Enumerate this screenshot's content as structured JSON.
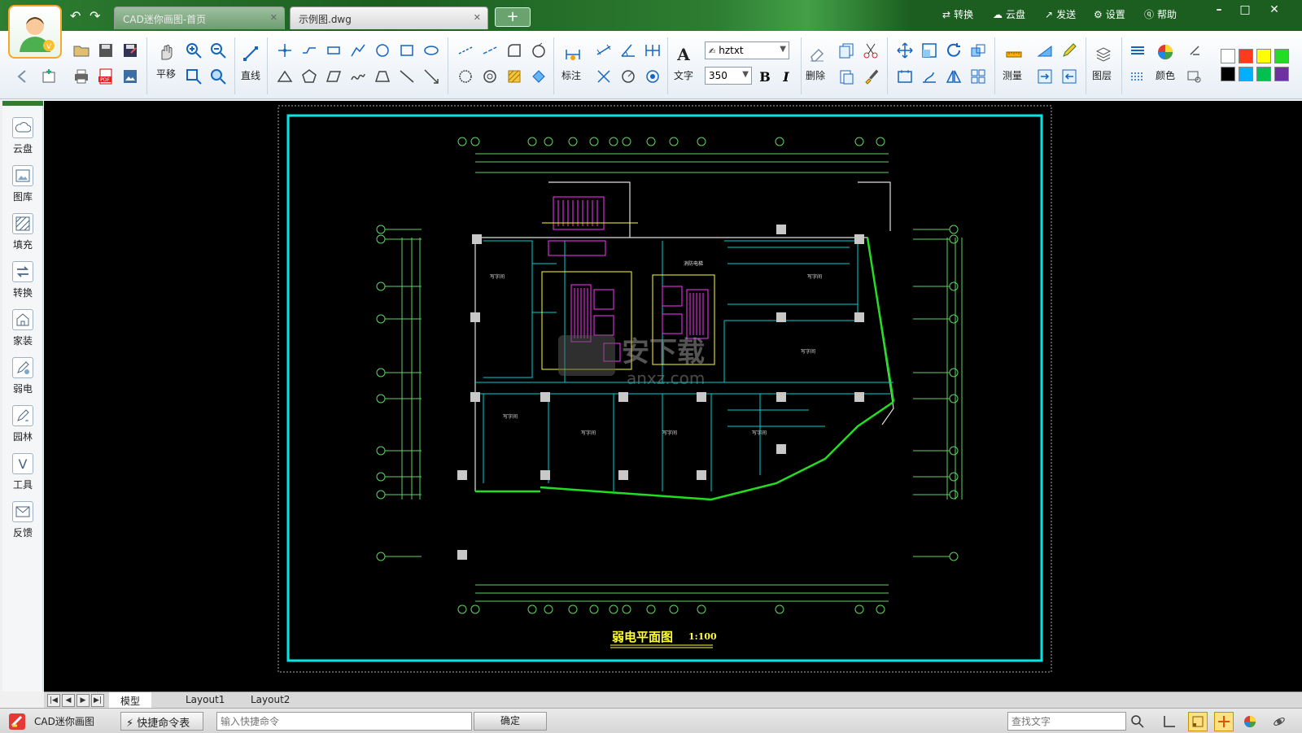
{
  "titlebar": {
    "tabs": [
      {
        "label": "CAD迷你画图-首页"
      },
      {
        "label": "示例图.dwg"
      }
    ],
    "add_tab": "+",
    "menu": {
      "convert": "转换",
      "cloud": "云盘",
      "send": "发送",
      "settings": "设置",
      "help": "帮助"
    }
  },
  "toolbar": {
    "pan": "平移",
    "line": "直线",
    "dimension": "标注",
    "text": "文字",
    "font": "hztxt",
    "font_size": "350",
    "bold": "B",
    "italic": "I",
    "delete": "删除",
    "measure": "测量",
    "layer": "图层",
    "color": "颜色",
    "colors": [
      "#ffffff",
      "#ff3b1f",
      "#ffff00",
      "#22dd22",
      "#000000",
      "#00b0ff",
      "#00c050",
      "#7030a0"
    ]
  },
  "sidebar": {
    "items": [
      {
        "label": "云盘",
        "icon": "cloud-icon"
      },
      {
        "label": "图库",
        "icon": "gallery-icon"
      },
      {
        "label": "填充",
        "icon": "hatch-icon"
      },
      {
        "label": "转换",
        "icon": "convert-icon"
      },
      {
        "label": "家装",
        "icon": "home-decor-icon"
      },
      {
        "label": "弱电",
        "icon": "weak-current-icon"
      },
      {
        "label": "园林",
        "icon": "garden-icon"
      },
      {
        "label": "工具",
        "icon": "tools-icon"
      },
      {
        "label": "反馈",
        "icon": "feedback-icon"
      }
    ]
  },
  "drawing": {
    "title": "弱电平面图",
    "scale": "1:100"
  },
  "layout_tabs": [
    {
      "label": "模型"
    },
    {
      "label": "Layout1"
    },
    {
      "label": "Layout2"
    }
  ],
  "statusbar": {
    "app_name": "CAD迷你画图",
    "shortcut_button": "快捷命令表",
    "command_placeholder": "输入快捷命令",
    "ok_button": "确定",
    "search_placeholder": "查找文字"
  }
}
